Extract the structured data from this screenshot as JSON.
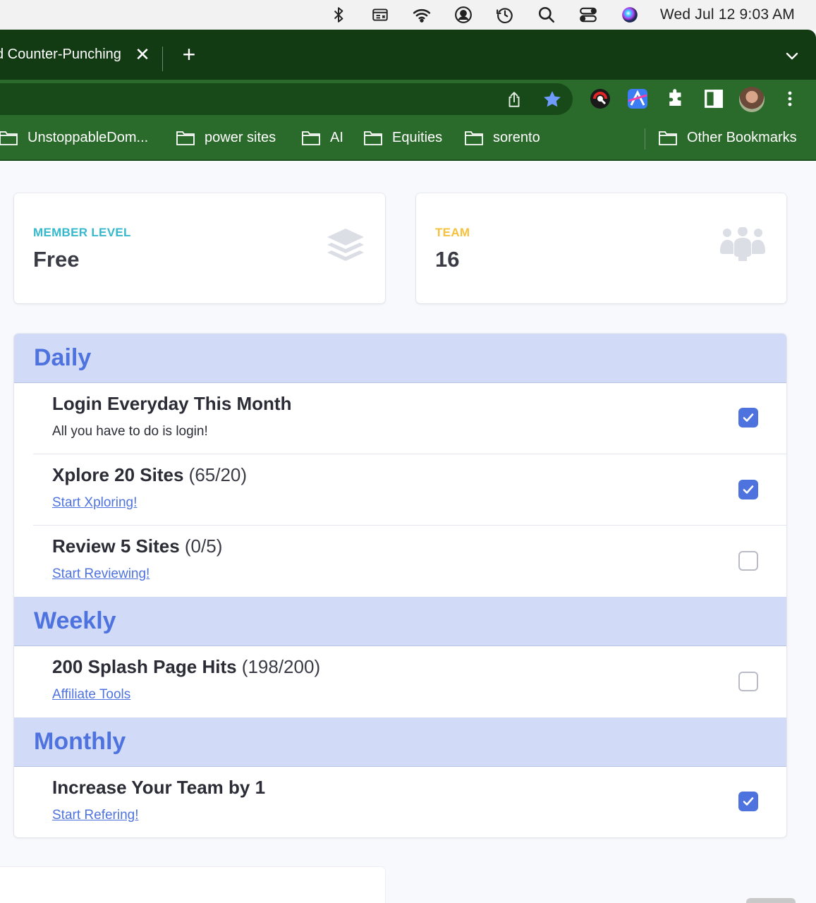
{
  "menubar": {
    "clock": "Wed Jul 12  9:03 AM",
    "icons": [
      "bluetooth-icon",
      "display-icon",
      "wifi-icon",
      "user-icon",
      "time-machine-icon",
      "spotlight-icon",
      "control-center-icon",
      "siri-icon"
    ]
  },
  "browser": {
    "tab_title": "d Counter-Punching",
    "tab_close": "✕",
    "new_tab": "+",
    "bookmarks": [
      {
        "label": "UnstoppableDom..."
      },
      {
        "label": "power sites"
      },
      {
        "label": "AI"
      },
      {
        "label": "Equities"
      },
      {
        "label": "sorento"
      }
    ],
    "other_bookmarks": "Other Bookmarks"
  },
  "stats": {
    "member": {
      "title": "MEMBER LEVEL",
      "value": "Free",
      "color": "#36b9cc"
    },
    "team": {
      "title": "TEAM",
      "value": "16",
      "color": "#f6c23e"
    }
  },
  "sections": {
    "daily": "Daily",
    "weekly": "Weekly",
    "monthly": "Monthly"
  },
  "tasks": {
    "login": {
      "name": "Login Everyday This Month",
      "sub": "All you have to do is login!",
      "checked": true
    },
    "xplore": {
      "name": "Xplore 20 Sites",
      "progress": "(65/20)",
      "link": "Start Xploring!",
      "checked": true
    },
    "review": {
      "name": "Review 5 Sites",
      "progress": "(0/5)",
      "link": "Start Reviewing!",
      "checked": false
    },
    "splash": {
      "name": "200 Splash Page Hits",
      "progress": "(198/200)",
      "link": "Affiliate Tools",
      "checked": false
    },
    "team": {
      "name": "Increase Your Team by 1",
      "link": "Start Refering!",
      "checked": true
    }
  },
  "colors": {
    "accent": "#4e73df",
    "section_bg": "#d1dbf7",
    "browser_dark": "#123a13",
    "browser_mid": "#2a6a2a"
  }
}
